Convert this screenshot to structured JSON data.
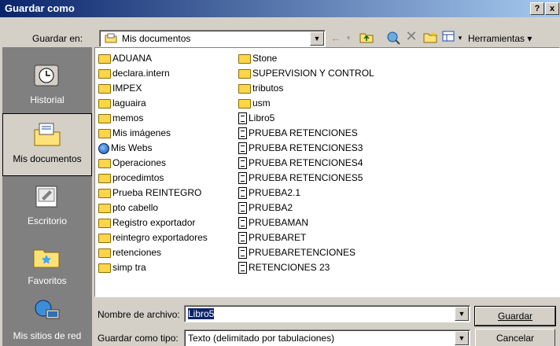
{
  "window": {
    "title": "Guardar como",
    "help_button": "?",
    "close_button": "x"
  },
  "toolbar": {
    "save_in_label": "Guardar en:",
    "save_in_value": "Mis documentos",
    "tools_label": "Herramientas"
  },
  "places": [
    {
      "label": "Historial",
      "selected": false,
      "icon": "history-icon"
    },
    {
      "label": "Mis documentos",
      "selected": true,
      "icon": "my-documents-folder-icon"
    },
    {
      "label": "Escritorio",
      "selected": false,
      "icon": "desktop-icon"
    },
    {
      "label": "Favoritos",
      "selected": false,
      "icon": "favorites-folder-icon"
    },
    {
      "label": "Mis sitios de red",
      "selected": false,
      "icon": "network-places-icon"
    }
  ],
  "files_col1": [
    {
      "name": "ADUANA",
      "type": "folder"
    },
    {
      "name": "declara.intern",
      "type": "folder"
    },
    {
      "name": "IMPEX",
      "type": "folder"
    },
    {
      "name": "laguaira",
      "type": "folder"
    },
    {
      "name": "memos",
      "type": "folder"
    },
    {
      "name": "Mis imágenes",
      "type": "folder"
    },
    {
      "name": "Mis Webs",
      "type": "webfolder"
    },
    {
      "name": "Operaciones",
      "type": "folder"
    },
    {
      "name": "procedimtos",
      "type": "folder"
    },
    {
      "name": "Prueba REINTEGRO",
      "type": "folder"
    },
    {
      "name": "pto cabello",
      "type": "folder"
    },
    {
      "name": "Registro exportador",
      "type": "folder"
    },
    {
      "name": "reintegro exportadores",
      "type": "folder"
    },
    {
      "name": "retenciones",
      "type": "folder"
    },
    {
      "name": "simp tra",
      "type": "folder"
    }
  ],
  "files_col2": [
    {
      "name": "Stone",
      "type": "folder"
    },
    {
      "name": "SUPERVISION Y CONTROL",
      "type": "folder"
    },
    {
      "name": "tributos",
      "type": "folder"
    },
    {
      "name": "usm",
      "type": "folder"
    },
    {
      "name": "Libro5",
      "type": "document"
    },
    {
      "name": "PRUEBA RETENCIONES",
      "type": "document"
    },
    {
      "name": "PRUEBA RETENCIONES3",
      "type": "document"
    },
    {
      "name": "PRUEBA RETENCIONES4",
      "type": "document"
    },
    {
      "name": "PRUEBA RETENCIONES5",
      "type": "document"
    },
    {
      "name": "PRUEBA2.1",
      "type": "document"
    },
    {
      "name": "PRUEBA2",
      "type": "document"
    },
    {
      "name": "PRUEBAMAN",
      "type": "document"
    },
    {
      "name": "PRUEBARET",
      "type": "document"
    },
    {
      "name": "PRUEBARETENCIONES",
      "type": "document"
    },
    {
      "name": "RETENCIONES 23",
      "type": "document"
    }
  ],
  "bottom": {
    "filename_label": "Nombre de archivo:",
    "filename_value": "Libro5",
    "filetype_label": "Guardar como tipo:",
    "filetype_value": "Texto (delimitado por tabulaciones)",
    "save_button": "Guardar",
    "cancel_button": "Cancelar"
  },
  "colors": {
    "titlebar": "#0a246a",
    "folder": "#ffd54a",
    "dialog_bg": "#d4d0c8"
  }
}
